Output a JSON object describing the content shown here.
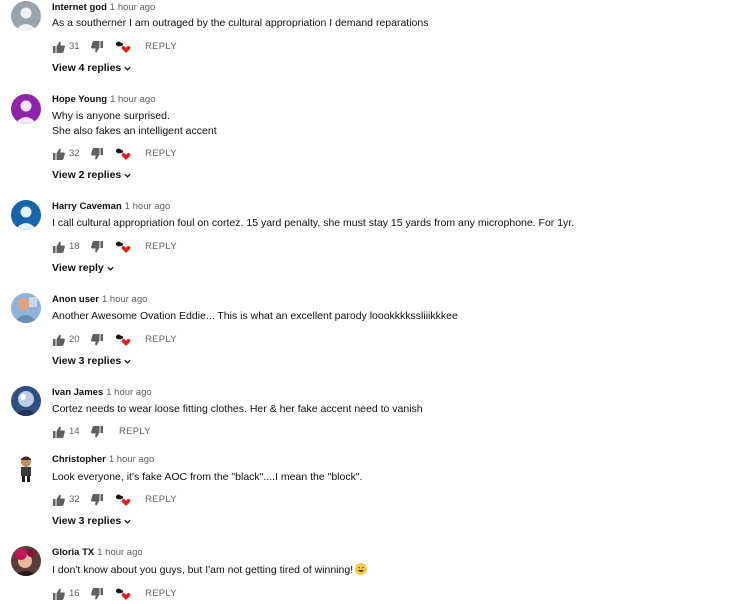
{
  "colors": {
    "like_icon": "#606060",
    "heart": "#e01f1f",
    "author": "#0f0f0f",
    "meta": "#606060"
  },
  "icons": {
    "like": "thumb-up-icon",
    "dislike": "thumb-down-icon",
    "creator_heart": "creator-heart-icon",
    "expand": "chevron-down-icon"
  },
  "comments": [
    {
      "author": "Internet god",
      "time": "1 hour ago",
      "lines": [
        "As a southerner I am outraged by the cultural appropriation I demand reparations"
      ],
      "likes": "31",
      "reply": "REPLY",
      "view_replies": "View 4 replies"
    },
    {
      "author": "Hope Young",
      "time": "1 hour ago",
      "lines": [
        "Why is anyone surprised.",
        "She also fakes an intelligent accent"
      ],
      "likes": "32",
      "reply": "REPLY",
      "view_replies": "View 2 replies"
    },
    {
      "author": "Harry Caveman",
      "time": "1 hour ago",
      "lines": [
        "I call cultural appropriation foul on cortez. 15 yard penalty, she must stay 15 yards from any microphone. For 1yr."
      ],
      "likes": "18",
      "reply": "REPLY",
      "view_replies": "View reply"
    },
    {
      "author": "Anon user",
      "time": "1 hour ago",
      "lines": [
        "Another Awesome Ovation Eddie... This is what an excellent parody loookkkkssliiikkkee"
      ],
      "likes": "20",
      "reply": "REPLY",
      "view_replies": "View 3 replies"
    },
    {
      "author": "Ivan James",
      "time": "1 hour ago",
      "lines": [
        "Cortez needs to wear loose fitting clothes. Her & her fake accent need to vanish"
      ],
      "likes": "14",
      "reply": "REPLY"
    },
    {
      "author": "Christopher",
      "time": "1 hour ago",
      "lines": [
        "Look everyone, it's fake AOC from the \"black\"....I mean the \"block\"."
      ],
      "likes": "32",
      "reply": "REPLY",
      "view_replies": "View 3 replies"
    },
    {
      "author": "Gloria TX",
      "time": "1 hour ago",
      "lines": [
        "I don't know about you guys, but I'am not getting tired of winning!"
      ],
      "likes": "16",
      "reply": "REPLY"
    }
  ]
}
